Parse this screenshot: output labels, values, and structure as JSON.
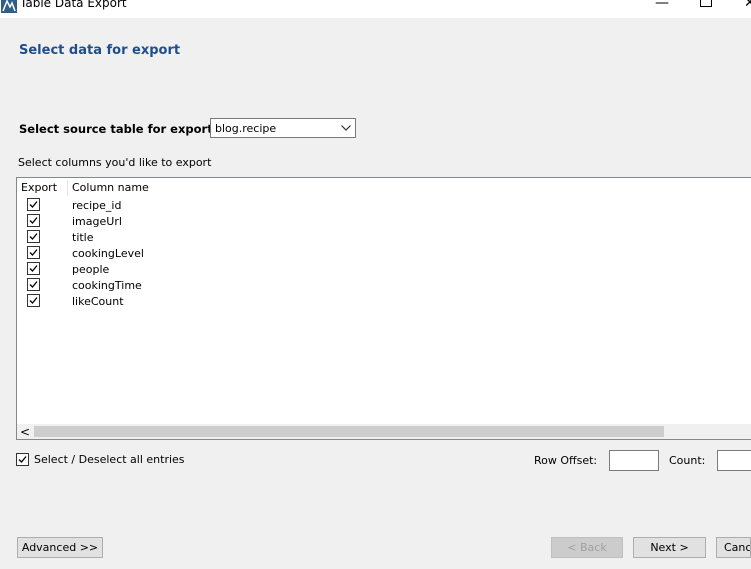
{
  "window": {
    "title": "Table Data Export",
    "minimize_glyph": "—",
    "close_glyph": "✕"
  },
  "page": {
    "title": "Select data for export"
  },
  "source": {
    "label": "Select source table for export:",
    "selected": "blog.recipe"
  },
  "columns": {
    "label": "Select columns you'd like to export",
    "headers": {
      "export": "Export",
      "column_name": "Column name"
    },
    "rows": [
      {
        "name": "recipe_id",
        "checked": true
      },
      {
        "name": "imageUrl",
        "checked": true
      },
      {
        "name": "title",
        "checked": true
      },
      {
        "name": "cookingLevel",
        "checked": true
      },
      {
        "name": "people",
        "checked": true
      },
      {
        "name": "cookingTime",
        "checked": true
      },
      {
        "name": "likeCount",
        "checked": true
      }
    ],
    "scroll_left_glyph": "<"
  },
  "select_all": {
    "label": "Select / Deselect all entries",
    "checked": true
  },
  "row_offset": {
    "label": "Row Offset:",
    "value": ""
  },
  "count": {
    "label": "Count:",
    "value": ""
  },
  "buttons": {
    "advanced": "Advanced >>",
    "back": "< Back",
    "next": "Next >",
    "cancel": "Cancel"
  },
  "colors": {
    "title_blue": "#1f4e8c",
    "window_bg": "#f0f0f0"
  }
}
